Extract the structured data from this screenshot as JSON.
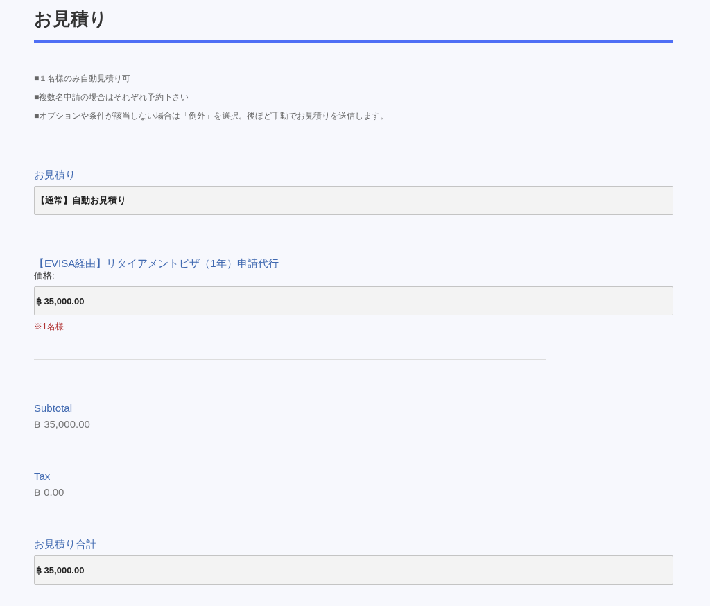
{
  "title": "お見積り",
  "notes": [
    "■１名様のみ自動見積り可",
    "■複数名申請の場合はそれぞれ予約下さい",
    "■オプションや条件が該当しない場合は「例外」を選択。後ほど手動でお見積りを送信します。"
  ],
  "quote_type": {
    "label": "お見積り",
    "value": "【通常】自動お見積り"
  },
  "product": {
    "name": "【EVISA経由】リタイアメントビザ（1年）申請代行",
    "price_label": "価格:",
    "price": "฿ 35,000.00",
    "note": "※1名様"
  },
  "subtotal": {
    "label": "Subtotal",
    "value": "฿ 35,000.00"
  },
  "tax": {
    "label": "Tax",
    "value": "฿ 0.00"
  },
  "total": {
    "label": "お見積り合計",
    "value": "฿ 35,000.00"
  }
}
